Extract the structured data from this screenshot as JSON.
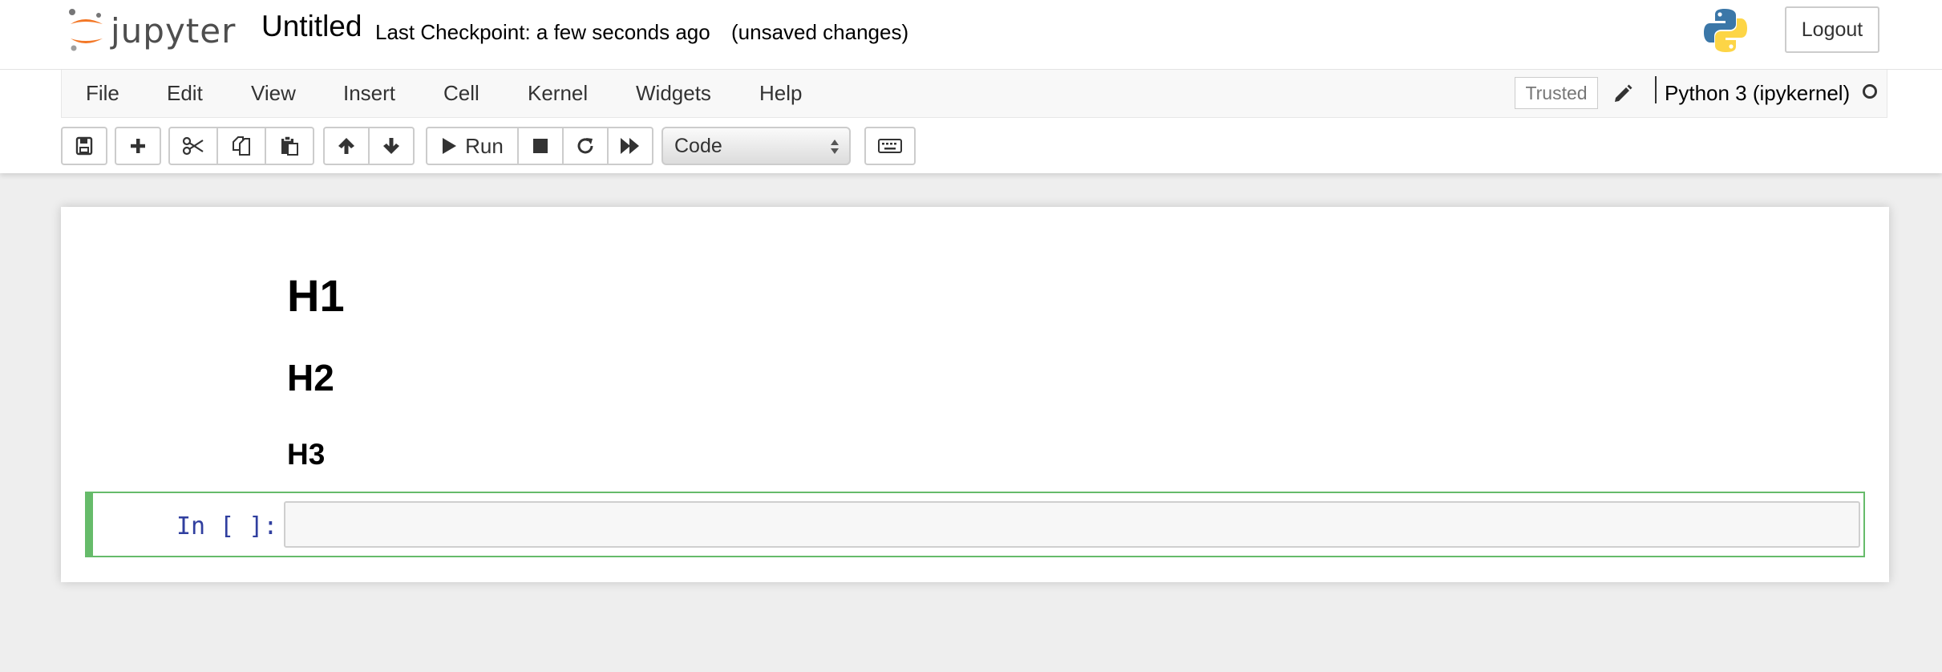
{
  "header": {
    "logo_text": "jupyter",
    "notebook_title": "Untitled",
    "checkpoint": "Last Checkpoint: a few seconds ago",
    "autosave_status": "(unsaved changes)",
    "logout_label": "Logout"
  },
  "menubar": {
    "items": [
      "File",
      "Edit",
      "View",
      "Insert",
      "Cell",
      "Kernel",
      "Widgets",
      "Help"
    ],
    "trusted_label": "Trusted",
    "kernel_name": "Python 3 (ipykernel)"
  },
  "toolbar": {
    "run_label": "Run",
    "cell_type": "Code",
    "icons": [
      "save-icon",
      "plus-icon",
      "cut-icon",
      "copy-icon",
      "paste-icon",
      "arrow-up-icon",
      "arrow-down-icon",
      "play-icon",
      "stop-icon",
      "restart-icon",
      "fast-forward-icon",
      "keyboard-icon"
    ]
  },
  "notebook": {
    "markdown": {
      "h1": "H1",
      "h2": "H2",
      "h3": "H3"
    },
    "code_cell": {
      "prompt": "In [ ]:",
      "source": ""
    }
  },
  "colors": {
    "logo_orange": "#f37726",
    "selected_cell_border": "#66bb6a",
    "prompt_blue": "#303f9f"
  }
}
